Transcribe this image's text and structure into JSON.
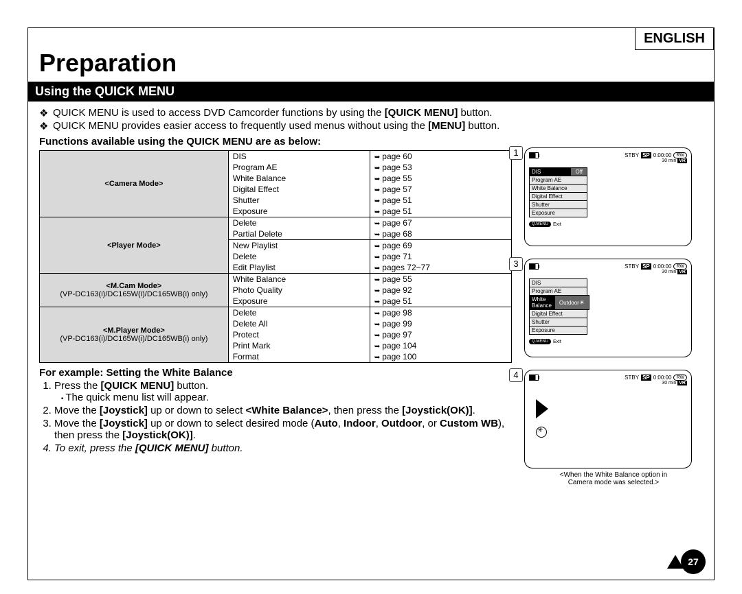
{
  "lang": "ENGLISH",
  "title": "Preparation",
  "section": "Using the QUICK MENU",
  "bullets": [
    {
      "pre": "QUICK MENU is used to access DVD Camcorder functions by using the ",
      "b": "[QUICK MENU]",
      "post": " button."
    },
    {
      "pre": "QUICK MENU provides easier access to frequently used menus without using the ",
      "b": "[MENU]",
      "post": " button."
    }
  ],
  "tableHead": "Functions available using the QUICK MENU are as below:",
  "table": [
    {
      "mode": "<Camera Mode>",
      "sub": "",
      "groups": [
        {
          "items": [
            "DIS",
            "Program AE",
            "White Balance",
            "Digital Effect",
            "Shutter",
            "Exposure"
          ],
          "pages": [
            "page 60",
            "page 53",
            "page 55",
            "page 57",
            "page 51",
            "page 51"
          ]
        }
      ]
    },
    {
      "mode": "<Player Mode>",
      "sub": "",
      "groups": [
        {
          "items": [
            "Delete",
            "Partial Delete"
          ],
          "pages": [
            "page 67",
            "page 68"
          ]
        },
        {
          "items": [
            "New Playlist",
            "Delete",
            "Edit Playlist"
          ],
          "pages": [
            "page 69",
            "page 71",
            "pages 72~77"
          ]
        }
      ]
    },
    {
      "mode": "<M.Cam Mode>",
      "sub": "(VP-DC163(i)/DC165W(i)/DC165WB(i) only)",
      "groups": [
        {
          "items": [
            "White Balance",
            "Photo Quality",
            "Exposure"
          ],
          "pages": [
            "page 55",
            "page 92",
            "page 51"
          ]
        }
      ]
    },
    {
      "mode": "<M.Player Mode>",
      "sub": "(VP-DC163(i)/DC165W(i)/DC165WB(i) only)",
      "groups": [
        {
          "items": [
            "Delete",
            "Delete All",
            "Protect",
            "Print Mark",
            "Format"
          ],
          "pages": [
            "page 98",
            "page 99",
            "page 97",
            "page 104",
            "page 100"
          ]
        }
      ]
    }
  ],
  "exampleHead": "For example: Setting the White Balance",
  "steps": {
    "s1a": "Press the ",
    "s1b": "[QUICK MENU]",
    "s1c": " button.",
    "s1sub": "The quick menu list will appear.",
    "s2a": "Move the ",
    "s2b": "[Joystick]",
    "s2c": " up or down to select ",
    "s2d": "<White Balance>",
    "s2e": ", then press the ",
    "s2f": "[Joystick(OK)]",
    "s2g": ".",
    "s3a": "Move the ",
    "s3b": "[Joystick]",
    "s3c": " up or down to select desired mode (",
    "s3d": "Auto",
    "s3e": ", ",
    "s3f": "Indoor",
    "s3g": ", ",
    "s3h": "Outdoor",
    "s3i": ", or ",
    "s3j": "Custom WB",
    "s3k": "), then press the ",
    "s3l": "[Joystick(OK)]",
    "s3m": ".",
    "s4a": "To exit, press the ",
    "s4b": "[QUICK MENU]",
    "s4c": " button."
  },
  "status": {
    "stby": "STBY",
    "sp": "SP",
    "time": "0:00:00",
    "rw": "RW",
    "min": "30 min",
    "vr": "VR",
    "qmenu": "Q.MENU",
    "exit": "Exit"
  },
  "menu": {
    "items": [
      "DIS",
      "Program AE",
      "White Balance",
      "Digital Effect",
      "Shutter",
      "Exposure"
    ],
    "offVal": "Off",
    "outdoorVal": "Outdoor"
  },
  "screenNums": [
    "1",
    "3",
    "4"
  ],
  "caption1": "<When the White Balance option in",
  "caption2": "Camera mode was selected.>",
  "pageNum": "27"
}
